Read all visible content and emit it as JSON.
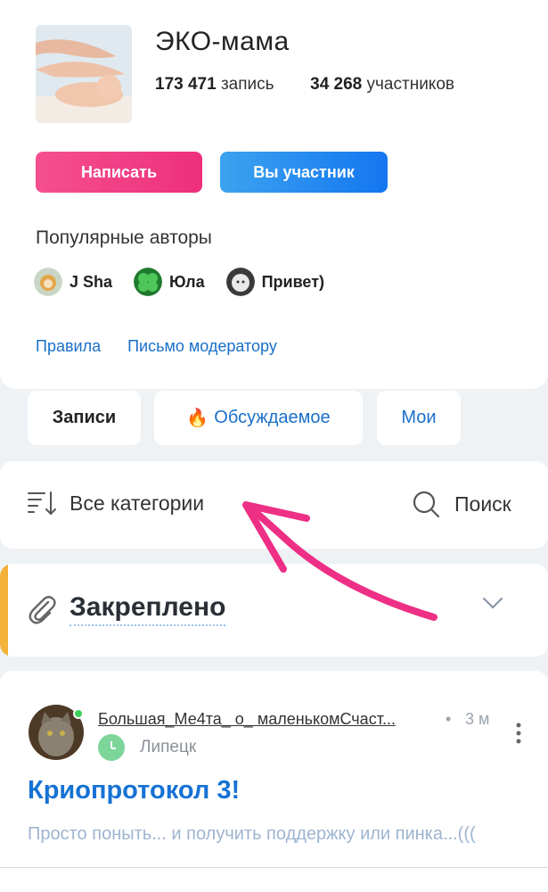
{
  "community": {
    "title": "ЭКО-мама",
    "posts_count": "173 471",
    "posts_label": "запись",
    "members_count": "34 268",
    "members_label": "участников"
  },
  "actions": {
    "write_label": "Написать",
    "member_label": "Вы участник"
  },
  "popular": {
    "label": "Популярные авторы",
    "authors": [
      {
        "name": "J Sha"
      },
      {
        "name": "Юла"
      },
      {
        "name": "Привет)"
      }
    ]
  },
  "links": {
    "rules": "Правила",
    "moderator": "Письмо модератору"
  },
  "tabs": {
    "posts": "Записи",
    "discussed": "Обсуждаемое",
    "mine": "Мои"
  },
  "filter": {
    "categories": "Все категории",
    "search": "Поиск"
  },
  "pinned": {
    "label": "Закреплено"
  },
  "post": {
    "author": "Большая_Ме4та_ о_ маленькомСчаст...",
    "time": "3 м",
    "city": "Липецк",
    "title": "Криопротокол 3!",
    "excerpt": "Просто поныть... и получить поддержку или пинка...((("
  },
  "colors": {
    "write_button": "#ee2f7b",
    "member_button": "#1476f0",
    "link": "#1a6fc9",
    "pinned_stripe": "#f4b23a",
    "annotation_arrow": "#ee2f86"
  }
}
